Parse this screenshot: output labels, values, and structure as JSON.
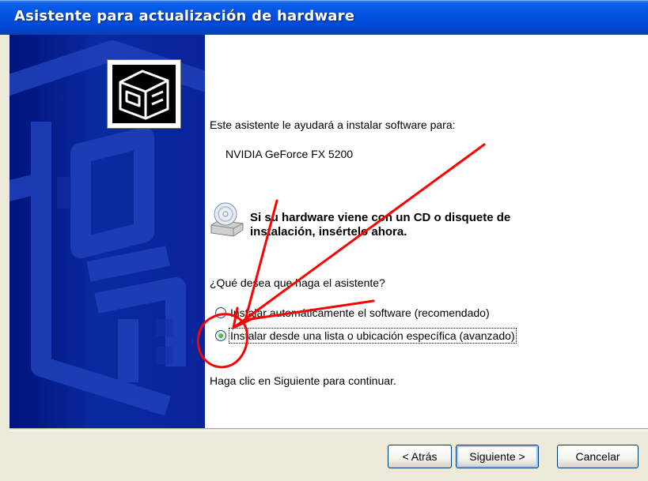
{
  "window": {
    "title": "Asistente para actualización de hardware"
  },
  "intro": {
    "line": "Este asistente le ayudará a instalar software para:",
    "device": "NVIDIA GeForce FX 5200"
  },
  "cd_notice": {
    "icon": "cd-drive-icon",
    "line1": "Si su hardware viene con un CD o disquete de",
    "line2": "instalación, insértelo ahora."
  },
  "question": "¿Qué desea que haga el asistente?",
  "options": [
    {
      "label": "Instalar automáticamente el software (recomendado)",
      "selected": false
    },
    {
      "label": "Instalar desde una lista o ubicación específica (avanzado)",
      "selected": true
    }
  ],
  "continue_hint": "Haga clic en Siguiente para continuar.",
  "buttons": {
    "back": "< Atrás",
    "next": "Siguiente >",
    "cancel": "Cancelar"
  },
  "colors": {
    "titlebar": "#0051e0",
    "side_panel": "#0a2aa0",
    "annotation": "#ff0000"
  }
}
